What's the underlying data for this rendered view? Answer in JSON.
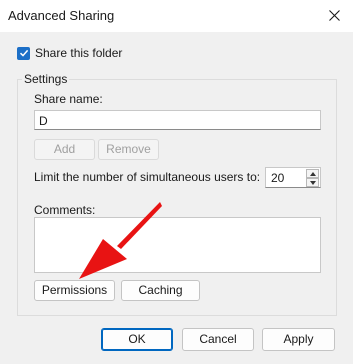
{
  "window": {
    "title": "Advanced Sharing"
  },
  "share_checkbox": {
    "label": "Share this folder",
    "checked": true
  },
  "settings": {
    "legend": "Settings",
    "share_name_label": "Share name:",
    "share_name_value": "D",
    "add_label": "Add",
    "remove_label": "Remove",
    "limit_label": "Limit the number of simultaneous users to:",
    "limit_value": "20",
    "comments_label": "Comments:",
    "permissions_label": "Permissions",
    "caching_label": "Caching"
  },
  "footer": {
    "ok_label": "OK",
    "cancel_label": "Cancel",
    "apply_label": "Apply"
  },
  "colors": {
    "accent": "#1c6fc7",
    "annotation": "#e81313"
  }
}
